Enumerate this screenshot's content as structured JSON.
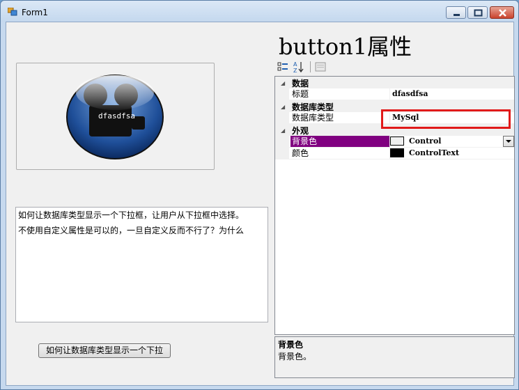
{
  "window": {
    "title": "Form1"
  },
  "left": {
    "button1_text": "dfasdfsa",
    "textbox_lines": [
      "如何让数据库类型显示一个下拉框，让用户从下拉框中选择。",
      "不使用自定义属性是可以的，一旦自定义反而不行了？为什么"
    ],
    "button2_label": "如何让数据库类型显示一个下拉"
  },
  "right": {
    "heading": "button1属性",
    "grid": {
      "categories": [
        {
          "label": "数据",
          "props": [
            {
              "name": "标题",
              "value": "dfasdfsa"
            }
          ]
        },
        {
          "label": "数据库类型",
          "props": [
            {
              "name": "数据库类型",
              "value": "MySql"
            }
          ]
        },
        {
          "label": "外观",
          "props": [
            {
              "name": "背景色",
              "value": "Control",
              "swatch": "#f0f0f0",
              "selected": true
            },
            {
              "name": "颜色",
              "value": "ControlText",
              "swatch": "#000000"
            }
          ]
        }
      ]
    },
    "help": {
      "title": "背景色",
      "description": "背景色。"
    }
  },
  "colors": {
    "selection": "#800080",
    "highlight_box": "#e11a1a"
  }
}
